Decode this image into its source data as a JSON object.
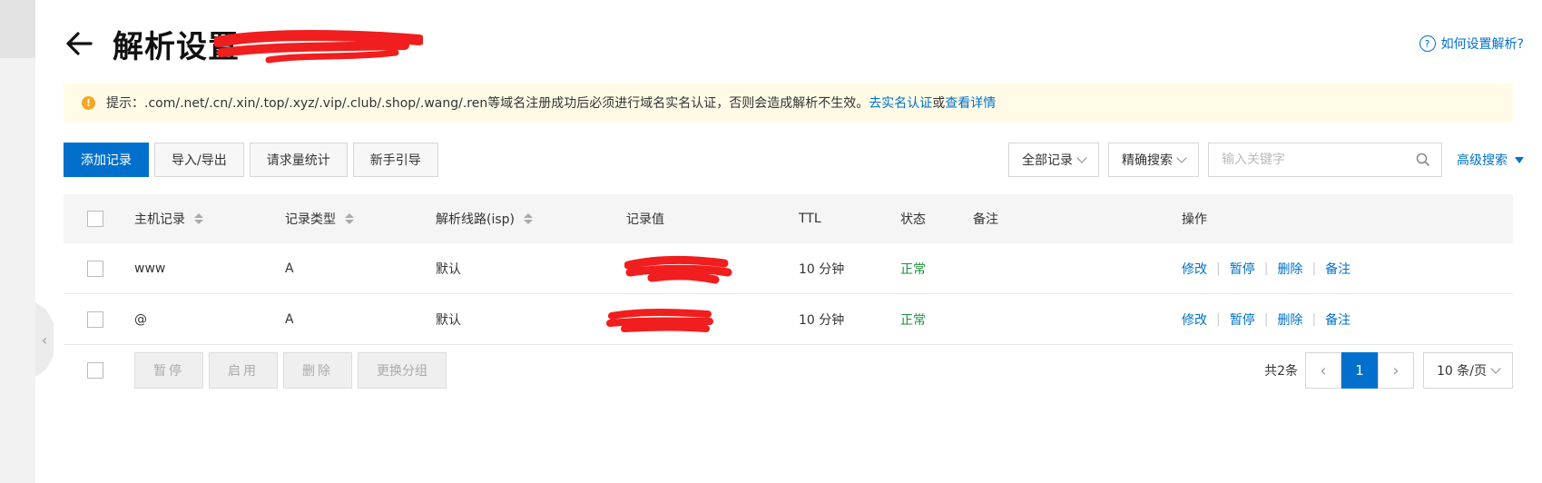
{
  "header": {
    "title": "解析设置",
    "help_link": "如何设置解析?"
  },
  "notice": {
    "text": "提示：.com/.net/.cn/.xin/.top/.xyz/.vip/.club/.shop/.wang/.ren等域名注册成功后必须进行域名实名认证，否则会造成解析不生效。",
    "link_verify": "去实名认证",
    "joiner": "或",
    "link_details": "查看详情"
  },
  "toolbar": {
    "add": "添加记录",
    "import_export": "导入/导出",
    "stats": "请求量统计",
    "guide": "新手引导"
  },
  "filters": {
    "record_filter": "全部记录",
    "search_mode": "精确搜索",
    "search_placeholder": "输入关键字",
    "advanced": "高级搜索"
  },
  "table": {
    "columns": {
      "host": "主机记录",
      "type": "记录类型",
      "line": "解析线路(isp)",
      "value": "记录值",
      "ttl": "TTL",
      "status": "状态",
      "remark": "备注",
      "actions": "操作"
    },
    "rows": [
      {
        "host": "www",
        "type": "A",
        "line": "默认",
        "ttl": "10 分钟",
        "status": "正常"
      },
      {
        "host": "@",
        "type": "A",
        "line": "默认",
        "ttl": "10 分钟",
        "status": "正常"
      }
    ],
    "actions": {
      "edit": "修改",
      "pause": "暂停",
      "delete": "删除",
      "remark": "备注"
    }
  },
  "bulk": {
    "pause": "暂停",
    "enable": "启用",
    "delete": "删除",
    "change_group": "更换分组"
  },
  "pagination": {
    "total": "共2条",
    "current": "1",
    "page_size": "10 条/页"
  },
  "colors": {
    "primary": "#0070cc",
    "success": "#1e8e3e",
    "notice_bg": "#fffbe6",
    "redaction": "#f01e1e"
  }
}
